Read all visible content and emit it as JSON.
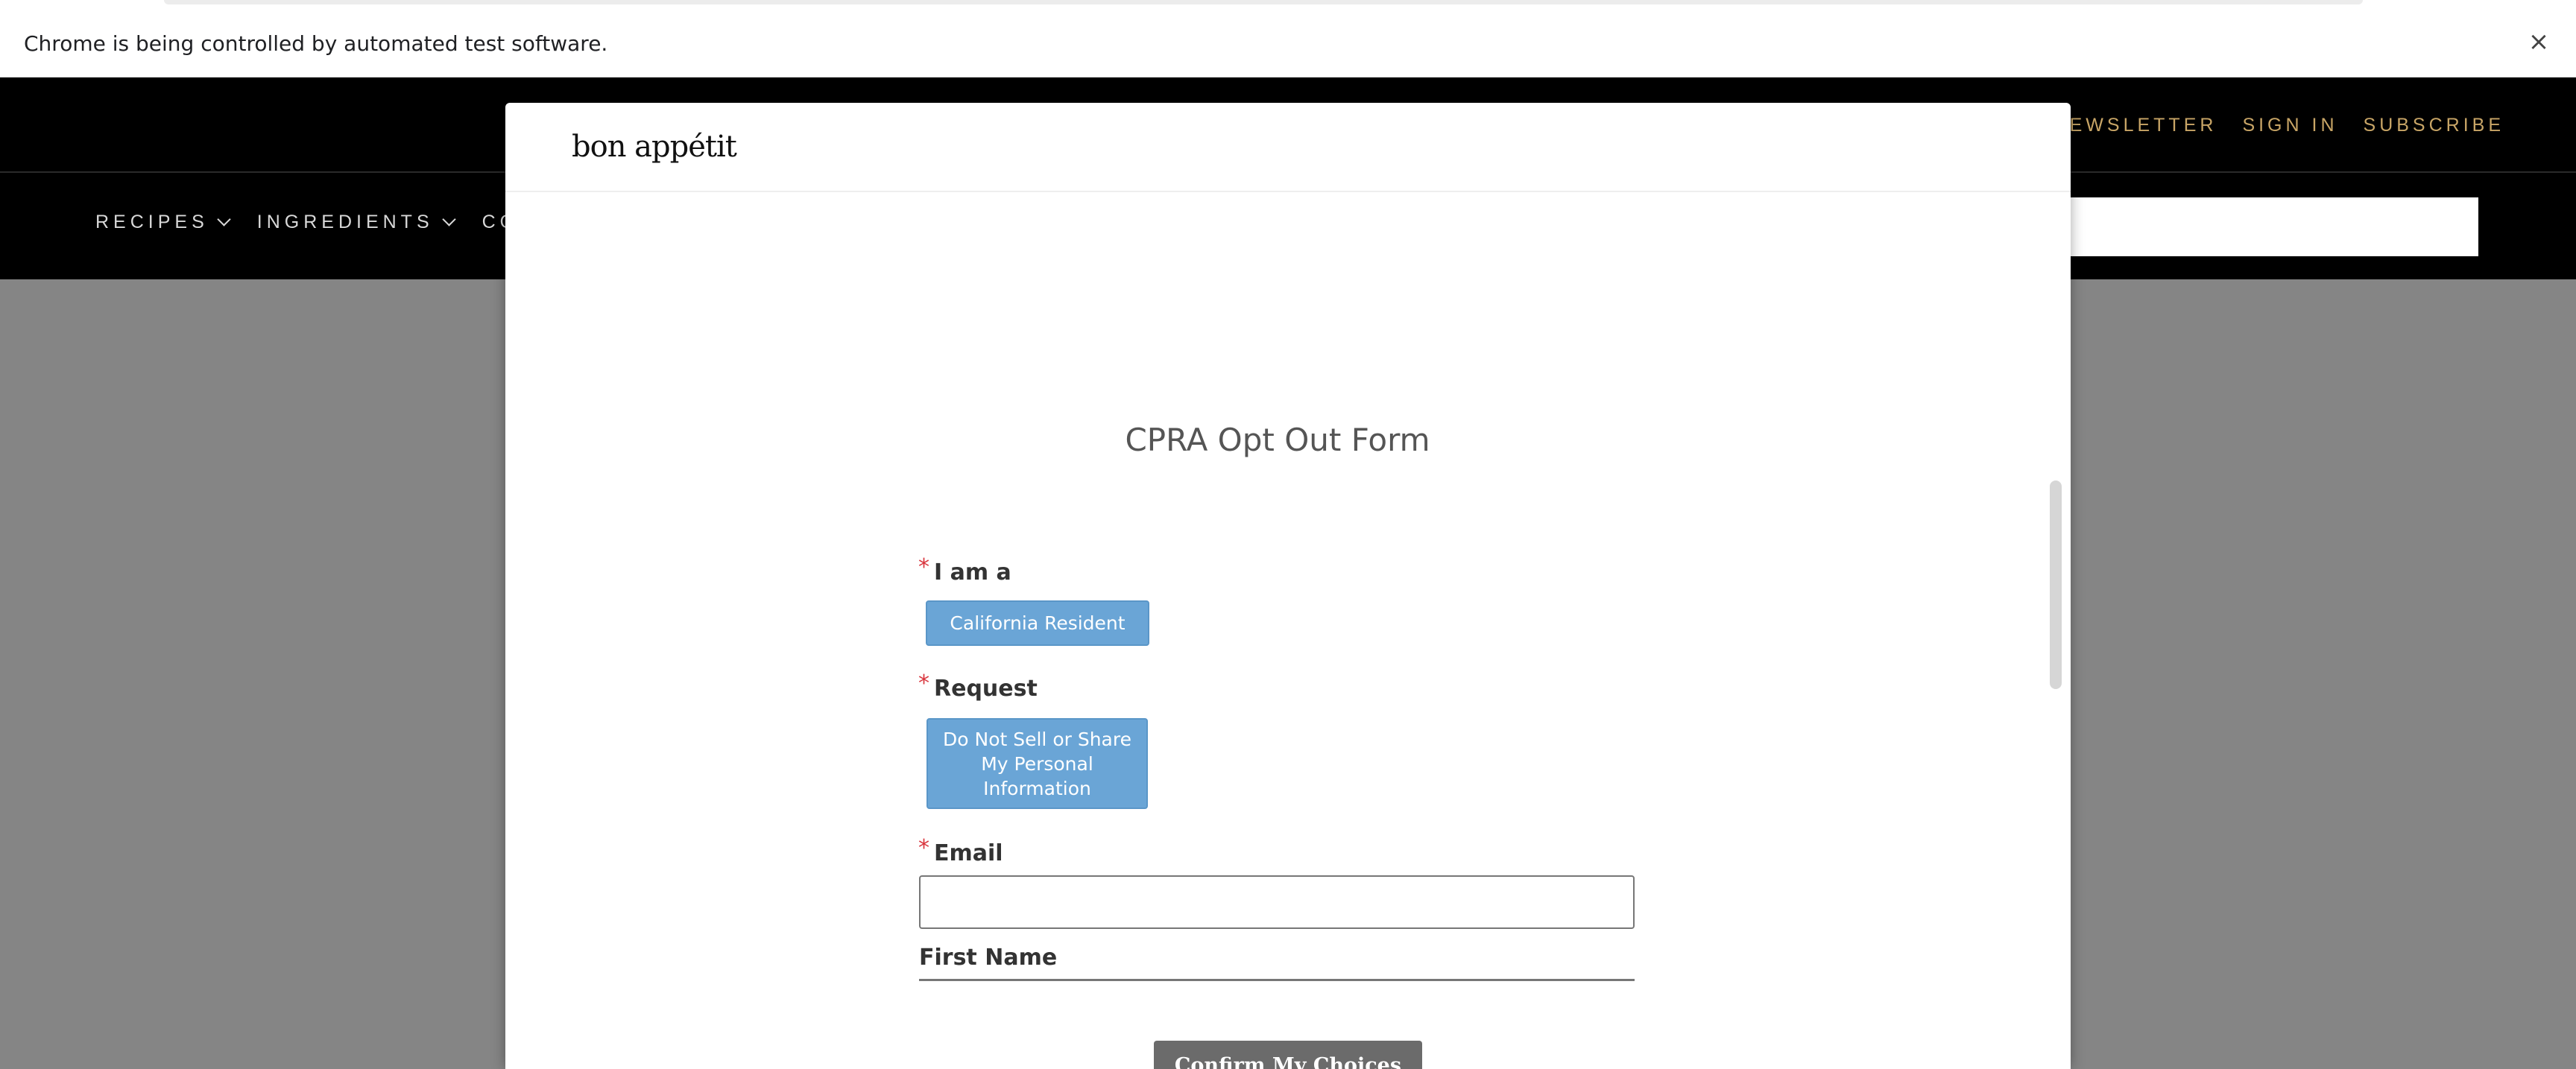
{
  "browser": {
    "infobar_text": "Chrome is being controlled by automated test software.",
    "infobar_close": "×"
  },
  "site": {
    "top_links": [
      "NEWSLETTER",
      "SIGN IN",
      "SUBSCRIBE"
    ],
    "nav": [
      {
        "label": "RECIPES",
        "has_dropdown": true
      },
      {
        "label": "INGREDIENTS",
        "has_dropdown": true
      },
      {
        "label": "COOKIN",
        "has_dropdown": false
      }
    ],
    "brand_color": "#c8a566"
  },
  "modal": {
    "logo": "bon appétit",
    "title": "CPRA Opt Out Form",
    "required_marker": "*",
    "fields": {
      "iam_label": "I am a",
      "iam_value": "California Resident",
      "request_label": "Request",
      "request_value": "Do Not Sell or Share My Personal Information",
      "email_label": "Email",
      "email_value": "",
      "first_name_label": "First Name"
    },
    "confirm_label": "Confirm My Choices",
    "choice_color": "#6aa5d6"
  }
}
